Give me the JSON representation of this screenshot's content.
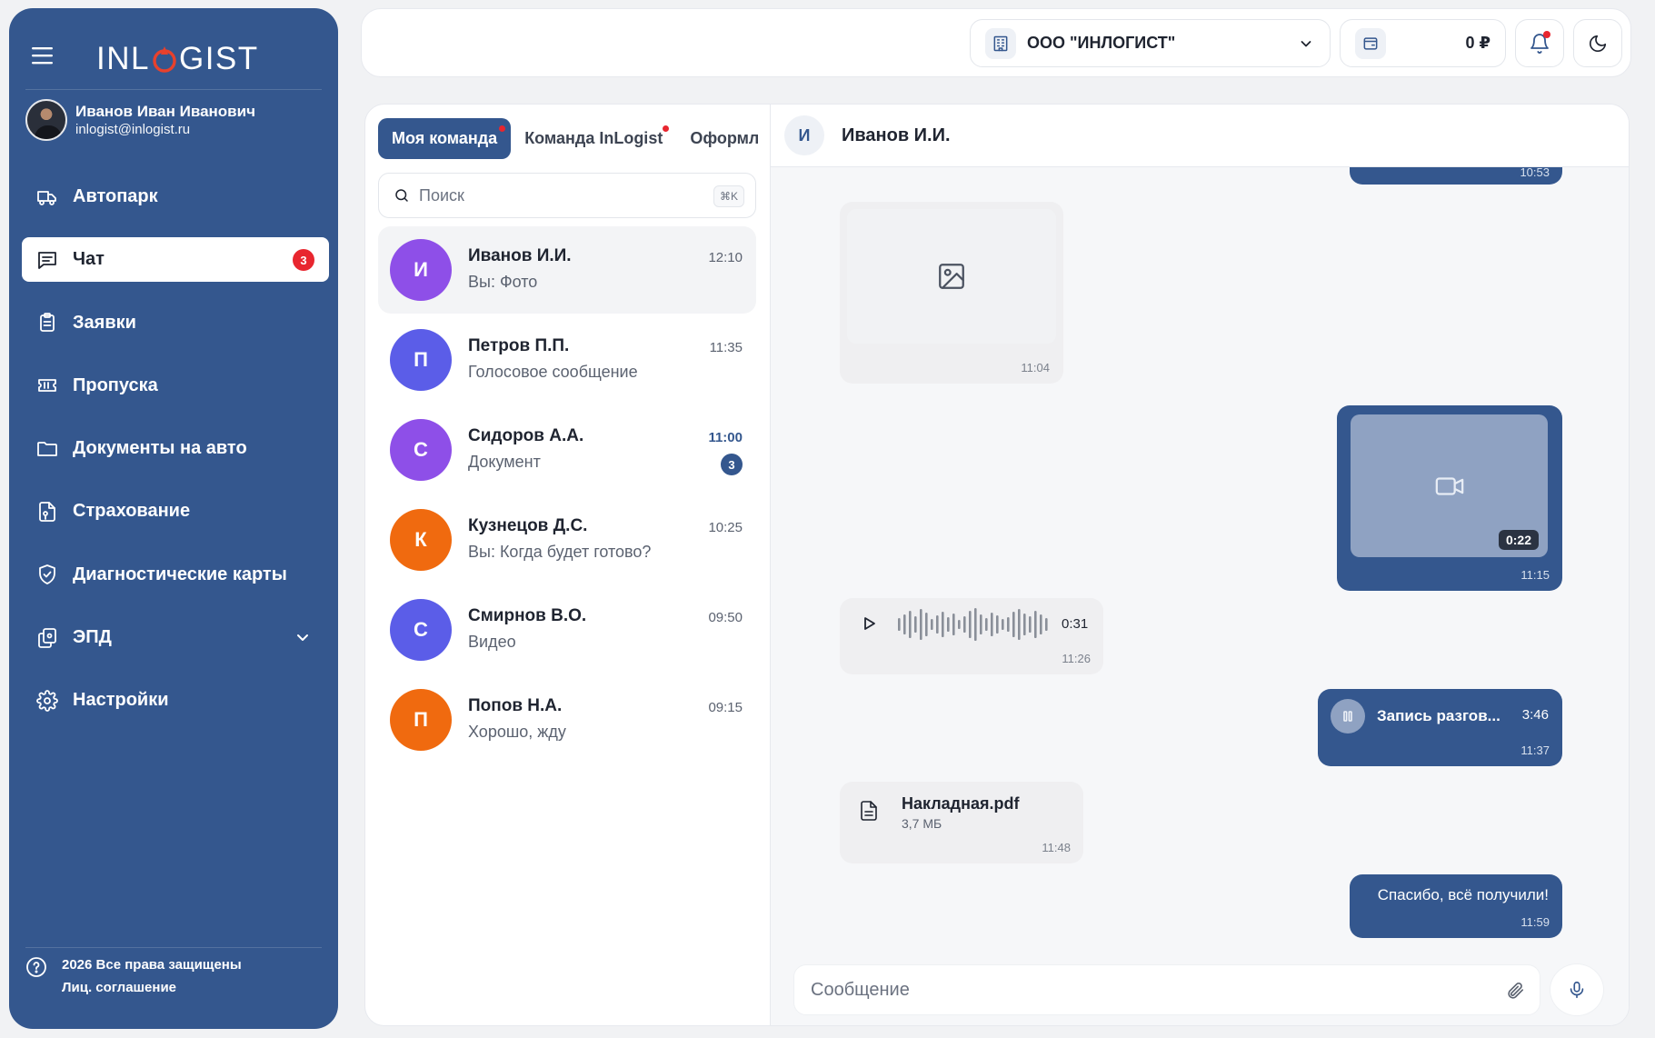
{
  "brand": {
    "logo_left": "INL",
    "logo_right": "GIST",
    "accent": "#34578e",
    "logo_o_color": "#e8412c"
  },
  "user": {
    "name": "Иванов Иван Иванович",
    "email": "inlogist@inlogist.ru"
  },
  "menu": [
    {
      "label": "Автопарк",
      "icon": "truck-icon"
    },
    {
      "label": "Чат",
      "icon": "chat-icon",
      "active": true,
      "badge": "3"
    },
    {
      "label": "Заявки",
      "icon": "clipboard-icon"
    },
    {
      "label": "Пропуска",
      "icon": "ticket-icon"
    },
    {
      "label": "Документы на авто",
      "icon": "folder-icon"
    },
    {
      "label": "Страхование",
      "icon": "insurance-icon"
    },
    {
      "label": "Диагностические карты",
      "icon": "shield-check-icon"
    },
    {
      "label": "ЭПД",
      "icon": "copy-icon",
      "has_submenu": true
    },
    {
      "label": "Настройки",
      "icon": "gear-icon"
    }
  ],
  "footer": {
    "line1": "2026 Все права защищены",
    "line2": "Лиц. соглашение"
  },
  "topbar": {
    "company": "ООО \"ИНЛОГИСТ\"",
    "balance": "0 ₽"
  },
  "chat_tabs": [
    {
      "label": "Моя команда",
      "active": true,
      "dot": true
    },
    {
      "label": "Команда InLogist",
      "dot": true
    },
    {
      "label": "Оформление",
      "dot": false
    }
  ],
  "search": {
    "placeholder": "Поиск",
    "shortcut": "⌘K"
  },
  "contacts": [
    {
      "initial": "И",
      "name": "Иванов И.И.",
      "last": "Вы: Фото",
      "time": "12:10",
      "color": "#8e4fe8",
      "active": true
    },
    {
      "initial": "П",
      "name": "Петров П.П.",
      "last": "Голосовое сообщение",
      "time": "11:35",
      "color": "#5b5de8"
    },
    {
      "initial": "С",
      "name": "Сидоров А.А.",
      "last": "Документ",
      "time": "11:00",
      "color": "#8e4fe8",
      "unread": "3"
    },
    {
      "initial": "К",
      "name": "Кузнецов Д.С.",
      "last": "Вы: Когда будет готово?",
      "time": "10:25",
      "color": "#f06a0f"
    },
    {
      "initial": "С",
      "name": "Смирнов В.О.",
      "last": "Видео",
      "time": "09:50",
      "color": "#5b5de8"
    },
    {
      "initial": "П",
      "name": "Попов Н.А.",
      "last": "Хорошо, жду",
      "time": "09:15",
      "color": "#f06a0f"
    }
  ],
  "conversation": {
    "initial": "И",
    "name": "Иванов И.И.",
    "messages": {
      "top_time": "10:53",
      "image_time": "11:04",
      "video_duration": "0:22",
      "video_time": "11:15",
      "voice_duration": "0:31",
      "voice_time": "11:26",
      "call_label": "Запись разгов...",
      "call_duration": "3:46",
      "call_time": "11:37",
      "file_name": "Накладная.pdf",
      "file_size": "3,7 МБ",
      "file_time": "11:48",
      "text": "Спасибо, всё получили!",
      "text_time": "11:59"
    },
    "composer_placeholder": "Сообщение"
  }
}
